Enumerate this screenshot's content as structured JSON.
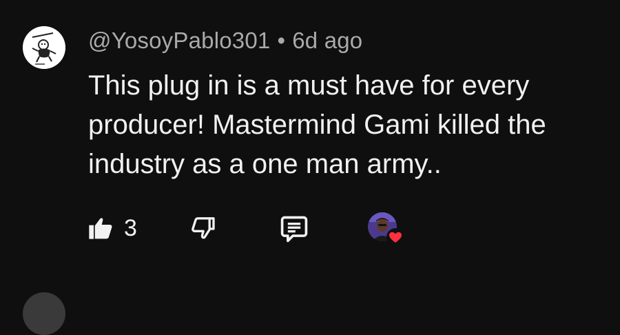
{
  "comment": {
    "author": "@YosoyPablo301",
    "separator": "•",
    "time": "6d ago",
    "text": "This plug in is a must have for every producer! Mastermind Gami killed the industry as a one man army..",
    "likes": "3"
  },
  "icons": {
    "like": "thumbs-up-icon",
    "dislike": "thumbs-down-icon",
    "reply": "reply-comment-icon",
    "creator_heart": "creator-heart-icon"
  },
  "colors": {
    "background": "#0f0f0f",
    "text": "#f1f1f1",
    "meta": "#aaaaaa",
    "heart": "#ff3040"
  }
}
